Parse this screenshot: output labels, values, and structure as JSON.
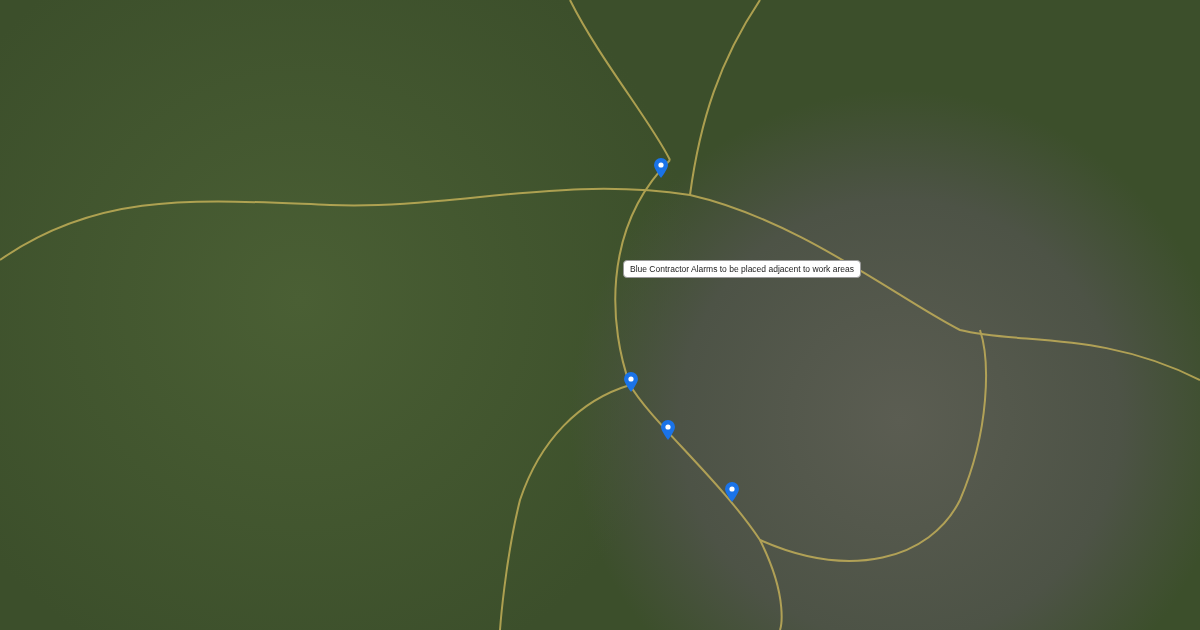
{
  "map": {
    "tooltip": "Blue Contractor Alarms to be placed adjacent to work areas",
    "markers": [
      {
        "kind": "pin"
      },
      {
        "kind": "pin"
      },
      {
        "kind": "pin"
      },
      {
        "kind": "pin"
      }
    ]
  }
}
